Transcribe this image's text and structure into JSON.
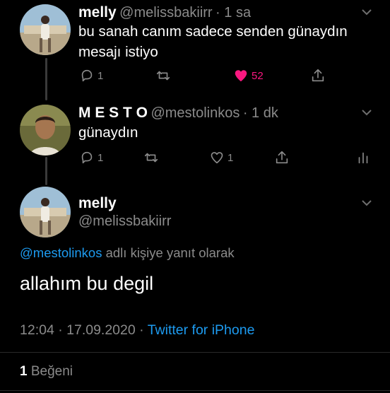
{
  "tweet1": {
    "name": "melly",
    "handle": "@melissbakiirr",
    "time": "· 1 sa",
    "text": "bu sanah canım sadece senden günaydın mesajı istiyo",
    "replies": "1",
    "likes": "52",
    "like_color": "#f91880"
  },
  "tweet2": {
    "name": "M E S T O",
    "handle": "@mestolinkos",
    "time": "· 1 dk",
    "text": "günaydın",
    "replies": "1",
    "likes": "1"
  },
  "main": {
    "name": "melly",
    "handle": "@melissbakiirr",
    "reply_to_handle": "@mestolinkos",
    "reply_to_suffix": "adlı kişiye yanıt olarak",
    "text": "allahım bu degil",
    "timestamp": "12:04 · 17.09.2020 · ",
    "source": "Twitter for iPhone",
    "like_count": "1",
    "like_label": "Beğeni"
  },
  "colors": {
    "accent": "#1d9bf0",
    "muted": "#8b8b8b",
    "background": "#000000"
  }
}
